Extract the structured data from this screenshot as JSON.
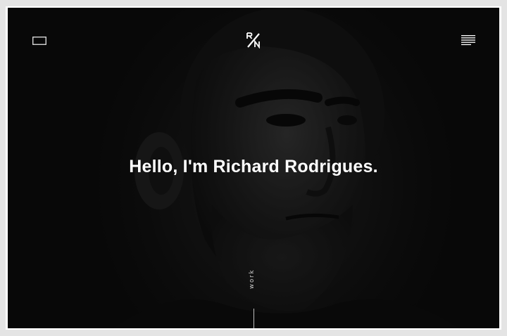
{
  "header": {
    "logo_icon": "rn-monogram-logo",
    "left_icon": "window-outline-icon",
    "menu_icon": "hamburger-menu-icon"
  },
  "hero": {
    "headline": "Hello, I'm Richard Rodrigues.",
    "background_image": "dark-monochrome-portrait"
  },
  "nav": {
    "work_label": "work"
  },
  "colors": {
    "background": "#111111",
    "text": "#ffffff",
    "frame": "#ffffff"
  }
}
